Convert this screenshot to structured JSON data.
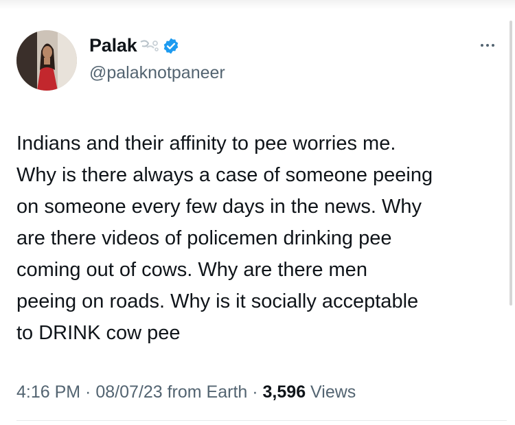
{
  "author": {
    "display_name": "Palak",
    "name_emoji": "dash-emoji-icon",
    "verified": "verified-badge-icon",
    "handle": "@palaknotpaneer"
  },
  "tweet": {
    "lines": [
      "Indians and their affinity to pee worries me.",
      "Why is there always a case of someone peeing",
      "on someone every few days in the news. Why",
      "are there videos of policemen drinking pee",
      "coming out of cows. Why are there men",
      "peeing on roads. Why is it socially acceptable",
      "to DRINK cow pee"
    ]
  },
  "meta": {
    "time": "4:16 PM",
    "separator1": " · ",
    "date": "08/07/23",
    "source": " from Earth",
    "separator2": " · ",
    "views_count": "3,596",
    "views_label": " Views"
  },
  "colors": {
    "verified": "#1d9bf0",
    "secondary_text": "#536471",
    "primary_text": "#0f1419"
  },
  "icons": {
    "more": "more-horizontal-icon"
  }
}
